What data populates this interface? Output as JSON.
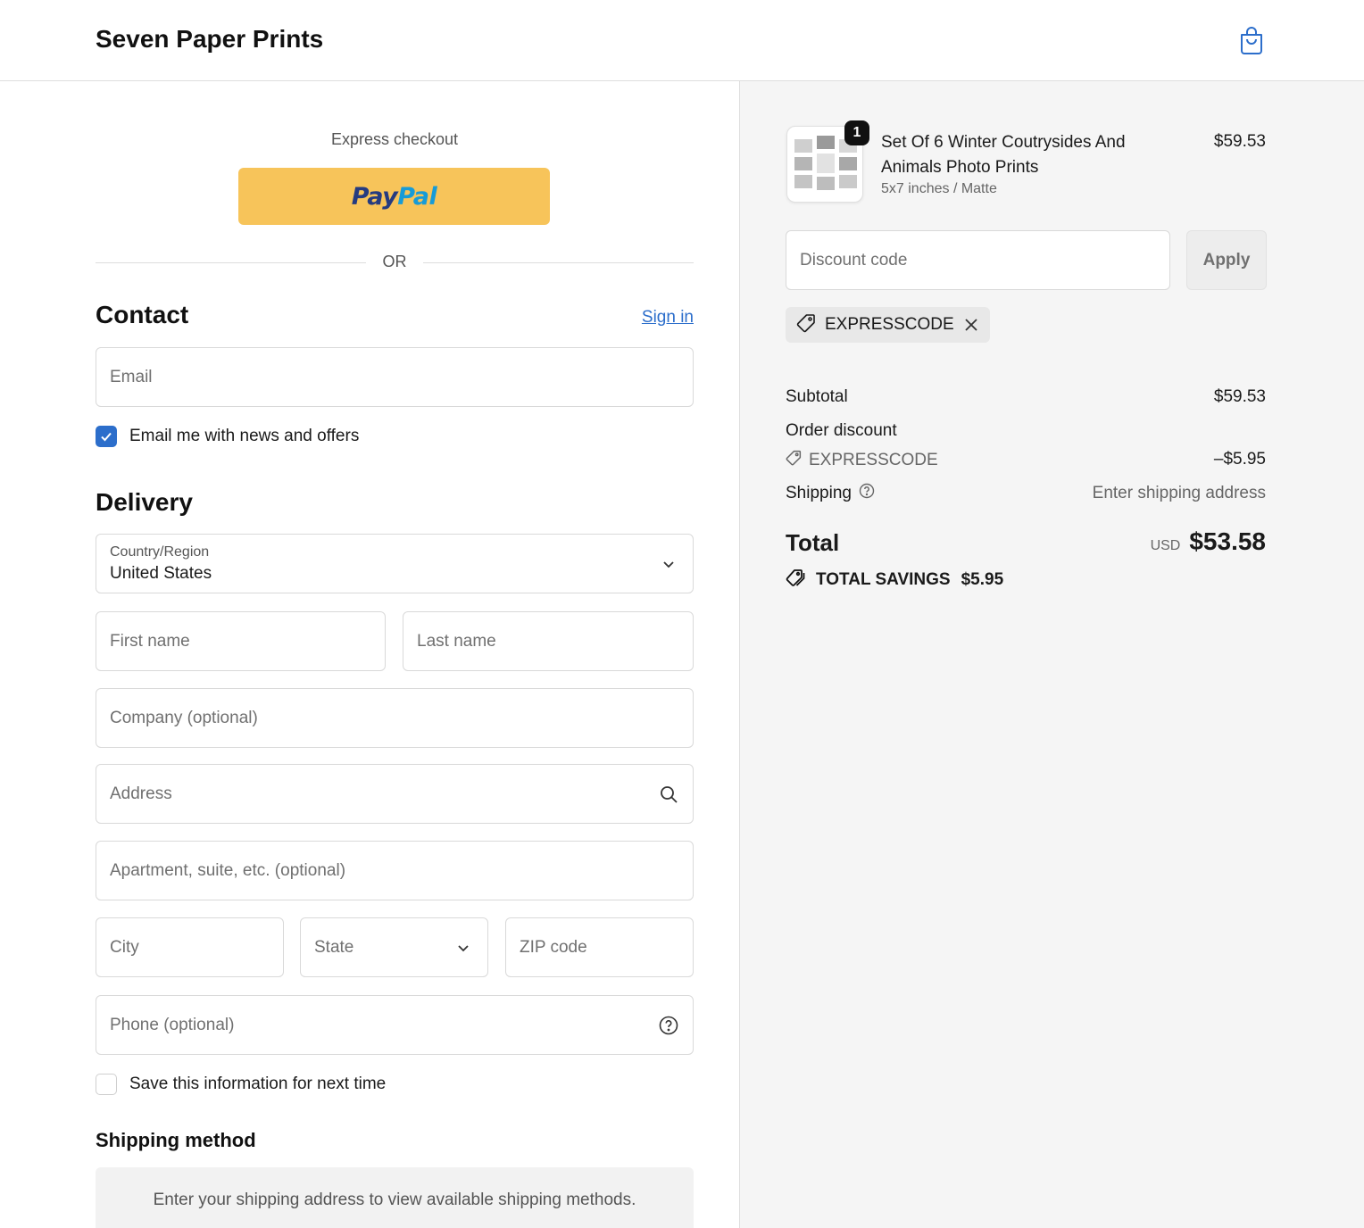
{
  "header": {
    "brand": "Seven Paper Prints"
  },
  "express": {
    "label": "Express checkout",
    "paypal_pay": "Pay",
    "paypal_pal": "Pal",
    "or": "OR"
  },
  "contact": {
    "title": "Contact",
    "sign_in": "Sign in",
    "email_placeholder": "Email",
    "news_label": "Email me with news and offers",
    "news_checked": true
  },
  "delivery": {
    "title": "Delivery",
    "country_label": "Country/Region",
    "country_value": "United States",
    "first_name_placeholder": "First name",
    "last_name_placeholder": "Last name",
    "company_placeholder": "Company (optional)",
    "address_placeholder": "Address",
    "apartment_placeholder": "Apartment, suite, etc. (optional)",
    "city_placeholder": "City",
    "state_label": "State",
    "zip_placeholder": "ZIP code",
    "phone_placeholder": "Phone (optional)",
    "save_label": "Save this information for next time",
    "save_checked": false
  },
  "shipping_method": {
    "title": "Shipping method",
    "message": "Enter your shipping address to view available shipping methods."
  },
  "summary": {
    "item": {
      "quantity": "1",
      "title": "Set Of 6 Winter Coutrysides And Animals Photo Prints",
      "variant": "5x7 inches / Matte",
      "price": "$59.53"
    },
    "discount_placeholder": "Discount code",
    "apply_label": "Apply",
    "applied_code": "EXPRESSCODE",
    "subtotal_label": "Subtotal",
    "subtotal_value": "$59.53",
    "order_discount_label": "Order discount",
    "discount_code": "EXPRESSCODE",
    "discount_value": "–$5.95",
    "shipping_label": "Shipping",
    "shipping_value": "Enter shipping address",
    "total_label": "Total",
    "total_currency": "USD",
    "total_value": "$53.58",
    "savings_label": "TOTAL SAVINGS",
    "savings_value": "$5.95"
  },
  "colors": {
    "accent": "#2c6ecb",
    "paypal_yellow": "#f7c45a",
    "summary_bg": "#f5f5f5"
  }
}
